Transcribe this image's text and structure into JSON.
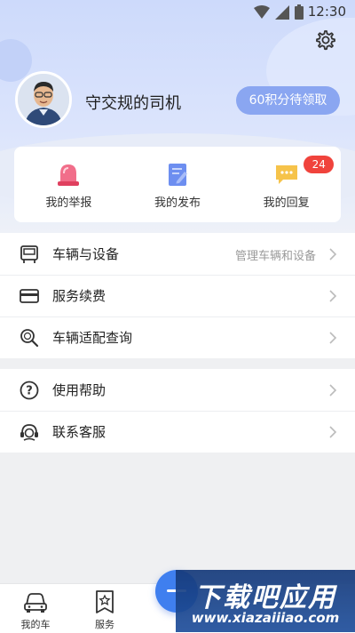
{
  "status_bar": {
    "time": "12:30"
  },
  "profile": {
    "username": "守交规的司机",
    "points_button": "60积分待领取"
  },
  "quick_actions": [
    {
      "label": "我的举报",
      "icon": "report-siren-icon"
    },
    {
      "label": "我的发布",
      "icon": "publish-note-icon"
    },
    {
      "label": "我的回复",
      "icon": "reply-chat-icon",
      "badge": "24"
    }
  ],
  "menu_group_1": [
    {
      "label": "车辆与设备",
      "hint": "管理车辆和设备",
      "icon": "vehicle-device-icon"
    },
    {
      "label": "服务续费",
      "icon": "card-icon"
    },
    {
      "label": "车辆适配查询",
      "icon": "search-icon"
    }
  ],
  "menu_group_2": [
    {
      "label": "使用帮助",
      "icon": "help-icon"
    },
    {
      "label": "联系客服",
      "icon": "customer-service-icon"
    }
  ],
  "bottom_nav": {
    "items": [
      {
        "label": "我的车",
        "icon": "car-icon"
      },
      {
        "label": "服务",
        "icon": "service-icon"
      }
    ]
  },
  "watermark": {
    "title": "下载吧应用",
    "url": "www.xiazaiiiao.com"
  },
  "colors": {
    "accent": "#3f7fef",
    "points_button": "#8aa6f1",
    "badge": "#f0433c",
    "header_gradient_top": "#cddafb"
  }
}
